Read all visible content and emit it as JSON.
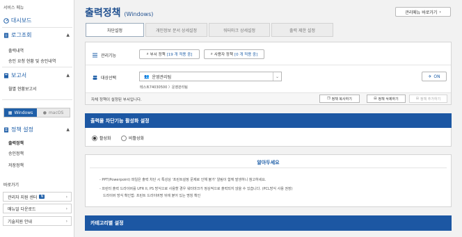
{
  "sidebar": {
    "service_menu": "서비스 메뉴",
    "dashboard": "대시보드",
    "log": {
      "label": "로그조회",
      "items": [
        "출력내역",
        "승인 요청 현황 및 승인내역"
      ]
    },
    "report": {
      "label": "보고서",
      "items": [
        "월별 현황보고서"
      ]
    },
    "os_toggle": [
      "Windows",
      "macOS"
    ],
    "policy": {
      "label": "정책 설정",
      "items": [
        "출력정책",
        "승인정책",
        "저장정책"
      ]
    },
    "shortcuts_title": "바로가기",
    "shortcuts": [
      "관리자 지원 센터",
      "매뉴얼 다운로드",
      "기술지원 안내"
    ],
    "new_badge": "N"
  },
  "header": {
    "title": "출력정책",
    "subtitle": "(Windows)",
    "admin_menu_button": "관리메뉴 바로가기"
  },
  "tabs": [
    "차단설정",
    "개인정보 문서 상세설정",
    "워터마크 상세설정",
    "출력 제한 설정"
  ],
  "policy_panel": {
    "function_label": "관리기능",
    "dept_policy": {
      "label": "부서 정책",
      "count": "[19 개 적용 중]"
    },
    "user_policy": {
      "label": "사용자 정책",
      "count": "[0 개 적용 중]"
    },
    "target_label": "대상선택",
    "selected_target": "운영관리팀",
    "target_path": "테스트74030500 〉운영관리팀",
    "on_button": "ON",
    "footer_msg": "자체 정책이 설정된 부서입니다.",
    "copy_button": "정책 복사하기",
    "delete_button": "정책 삭제하기",
    "add_button": "정책 추가하기"
  },
  "block_section": {
    "title": "출력물 차단기능 활성화 설정",
    "enable": "활성화",
    "disable": "비활성화"
  },
  "notice": {
    "title": "알아두세요",
    "line1": "- PPT(Powerpoint) 파일은 출력 차단 시 특성상 '프린트설정 문제로 인해 불가' 알림이 함께 발생하니 참고하세요.",
    "line2": "- 프린터 출력 드라이버를 UFR II, PS 방식으로 사용할 경우 워터마크가 정상적으로 출력되지 않을 수 있습니다. (PCL방식 사용 권장)",
    "line3": "드라이버 방식 확인법: 프린트 드라이버명 뒤에 붙어 있는 명칭 확인"
  },
  "category_section": {
    "title": "카테고리별 설정"
  }
}
